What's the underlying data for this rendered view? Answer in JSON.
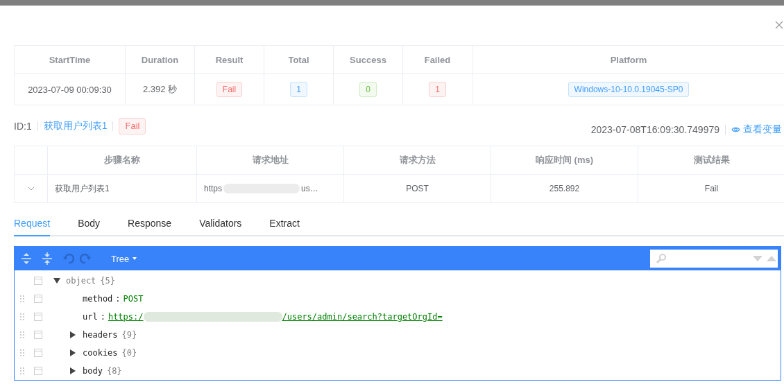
{
  "summary": {
    "columns": [
      "StartTime",
      "Duration",
      "Result",
      "Total",
      "Success",
      "Failed",
      "Platform"
    ],
    "row": [
      {
        "text": "2023-07-09 00:09:30"
      },
      {
        "text": "2.392 秒"
      },
      {
        "text": "Fail",
        "color": "#f56c6c"
      },
      {
        "text": "1",
        "color": "#409eff"
      },
      {
        "text": "0",
        "color": "#67c23a"
      },
      {
        "text": "1",
        "color": "#f56c6c"
      },
      {
        "text": "Windows-10-10.0.19045-SP0",
        "color": "#409eff"
      }
    ]
  },
  "step_header": {
    "id": "ID:1",
    "name": "获取用户列表1",
    "result": {
      "text": "Fail",
      "color": "#f56c6c"
    },
    "timestamp": "2023-07-08T16:09:30.749979",
    "variables_link": "查看变量"
  },
  "steps": {
    "columns": [
      "步骤名称",
      "请求地址",
      "请求方法",
      "响应时间 (ms)",
      "测试结果"
    ],
    "rows": [
      {
        "name": "获取用户列表1",
        "url_start": "https",
        "url_end": "us…",
        "method": "POST",
        "time": "255.892",
        "result": "Fail"
      }
    ]
  },
  "tabs": [
    {
      "label": "Request",
      "selected": true
    },
    {
      "label": "Body",
      "selected": false
    },
    {
      "label": "Response",
      "selected": false
    },
    {
      "label": "Validators",
      "selected": false
    },
    {
      "label": "Extract",
      "selected": false
    }
  ],
  "editor": {
    "mode": "Tree",
    "root": {
      "label": "object",
      "count": "{5}",
      "expanded": true
    },
    "nodes": [
      {
        "kind": "value",
        "key": "method",
        "separator": ":",
        "value": "POST",
        "link": false
      },
      {
        "kind": "value",
        "key": "url",
        "separator": ":",
        "value": "https:/",
        "value_after_blur": "/users/admin/search?targetOrgId=",
        "link": true
      },
      {
        "kind": "object",
        "key": "headers",
        "count": "{9}",
        "expanded": false
      },
      {
        "kind": "object",
        "key": "cookies",
        "count": "{0}",
        "expanded": false
      },
      {
        "kind": "object",
        "key": "body",
        "count": "{8}",
        "expanded": false
      }
    ]
  }
}
